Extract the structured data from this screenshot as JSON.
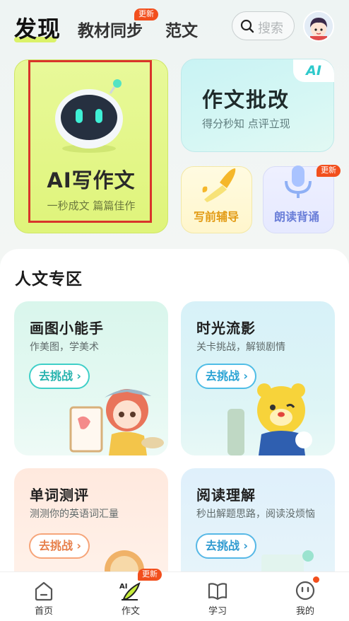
{
  "header": {
    "tabs": [
      {
        "label": "发现",
        "active": true
      },
      {
        "label": "教材同步",
        "badge": "更新"
      },
      {
        "label": "范文"
      }
    ],
    "search_placeholder": "搜索"
  },
  "cards": {
    "ai_write": {
      "title": "AI写作文",
      "subtitle": "一秒成文 篇篇佳作"
    },
    "ai_correct": {
      "tag": "AI",
      "title": "作文批改",
      "subtitle": "得分秒知 点评立现"
    },
    "pre_write": {
      "label": "写前辅导"
    },
    "read_recite": {
      "label": "朗读背诵",
      "badge": "更新"
    }
  },
  "section": {
    "title": "人文专区",
    "items": [
      {
        "title": "画图小能手",
        "subtitle": "作美图，学美术",
        "button": "去挑战"
      },
      {
        "title": "时光流影",
        "subtitle": "关卡挑战，解锁剧情",
        "button": "去挑战"
      },
      {
        "title": "单词测评",
        "subtitle": "测测你的英语词汇量",
        "button": "去挑战"
      },
      {
        "title": "阅读理解",
        "subtitle": "秒出解题思路，阅读没烦恼",
        "button": "去挑战"
      }
    ]
  },
  "bottom_nav": {
    "items": [
      {
        "label": "首页",
        "icon": "home-icon"
      },
      {
        "label": "作文",
        "icon": "ai-pen-icon",
        "badge": "更新",
        "active": true
      },
      {
        "label": "学习",
        "icon": "book-icon"
      },
      {
        "label": "我的",
        "icon": "smiley-icon",
        "dot": true
      }
    ]
  },
  "colors": {
    "accent_lime": "#dff47a",
    "badge_red": "#f24f1d",
    "teal": "#27b3ae",
    "highlight_border": "#d9342b"
  }
}
